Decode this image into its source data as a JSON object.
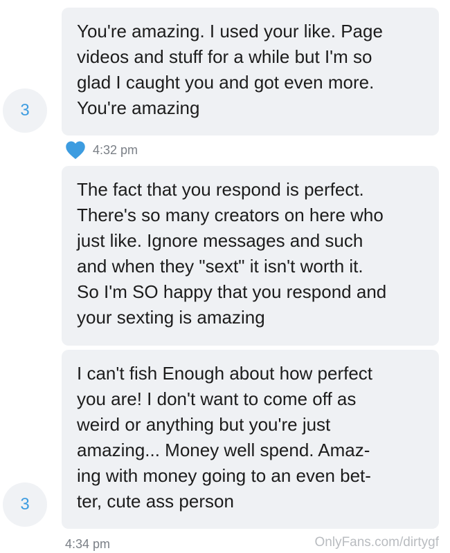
{
  "messages": [
    {
      "avatar_label": "3",
      "lines": [
        "You're amazing. I used your like. Page",
        "videos and stuff for a while but I'm so",
        "glad I caught you and got even more.",
        "You're amazing"
      ]
    },
    {
      "lines": [
        "The fact that you respond is perfect.",
        "There's so many creators on here who",
        "just like. Ignore messages and such",
        "and when they \"sext\" it isn't worth it.",
        "So I'm SO happy that you respond and",
        "your sexting is amazing"
      ]
    },
    {
      "avatar_label": "3",
      "lines": [
        "I can't fish Enough about how perfect",
        "you are! I don't want to come off as",
        "weird or anything but you're just",
        "amazing... Money well spend. Amaz-",
        "ing with money going to an even bet-",
        "ter, cute ass person"
      ]
    }
  ],
  "meta": {
    "first_time": "4:32 pm",
    "second_time": "4:34 pm",
    "like_icon": "heart-icon",
    "like_color": "#3d9ce0"
  },
  "watermark": "OnlyFans.com/dirtygf"
}
